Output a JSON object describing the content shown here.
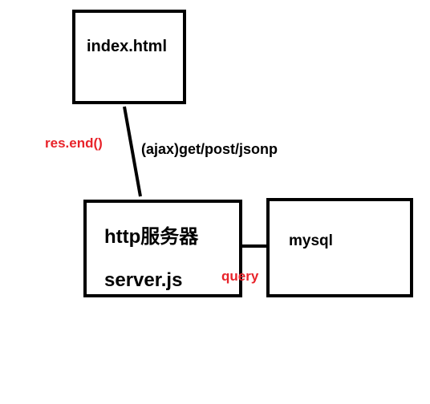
{
  "nodes": {
    "client": {
      "label": "index.html"
    },
    "server": {
      "title": "http服务器",
      "file": "server.js"
    },
    "database": {
      "label": "mysql"
    }
  },
  "edges": {
    "client_server": {
      "request_label": "(ajax)get/post/jsonp",
      "response_label": "res.end()"
    },
    "server_database": {
      "label": "query"
    }
  },
  "colors": {
    "stroke": "#000000",
    "annotation": "#e8232a",
    "background": "#ffffff"
  }
}
